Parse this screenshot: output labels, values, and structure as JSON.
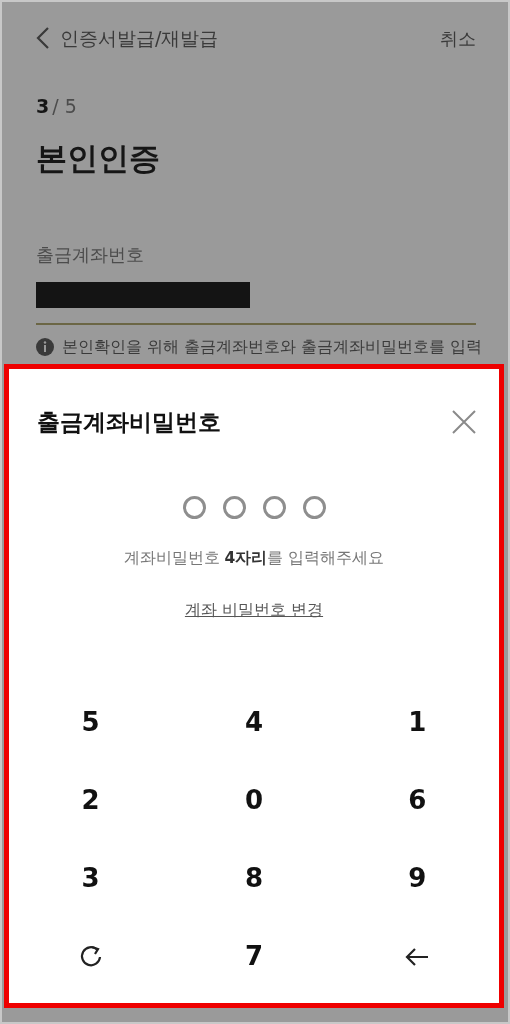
{
  "header": {
    "title": "인증서발급/재발급",
    "cancel": "취소"
  },
  "step": {
    "current": "3",
    "rest": "/ 5"
  },
  "page_title": "본인인증",
  "account": {
    "label": "출금계좌번호",
    "redacted": true
  },
  "notice": "본인확인을 위해 출금계좌번호와 출금계좌비밀번호를 입력",
  "sheet": {
    "title": "출금계좌비밀번호",
    "pin_dots": [
      {
        "filled": false
      },
      {
        "filled": false
      },
      {
        "filled": false
      },
      {
        "filled": false
      }
    ],
    "hint": "계좌비밀번호 **4자리**를 입력해주세요",
    "change_link": "계좌 비밀번호 변경",
    "keys": [
      {
        "kind": "digit",
        "label": "5"
      },
      {
        "kind": "digit",
        "label": "4"
      },
      {
        "kind": "digit",
        "label": "1"
      },
      {
        "kind": "digit",
        "label": "2"
      },
      {
        "kind": "digit",
        "label": "0"
      },
      {
        "kind": "digit",
        "label": "6"
      },
      {
        "kind": "digit",
        "label": "3"
      },
      {
        "kind": "digit",
        "label": "8"
      },
      {
        "kind": "digit",
        "label": "9"
      },
      {
        "kind": "refresh"
      },
      {
        "kind": "digit",
        "label": "7"
      },
      {
        "kind": "backspace"
      }
    ]
  }
}
